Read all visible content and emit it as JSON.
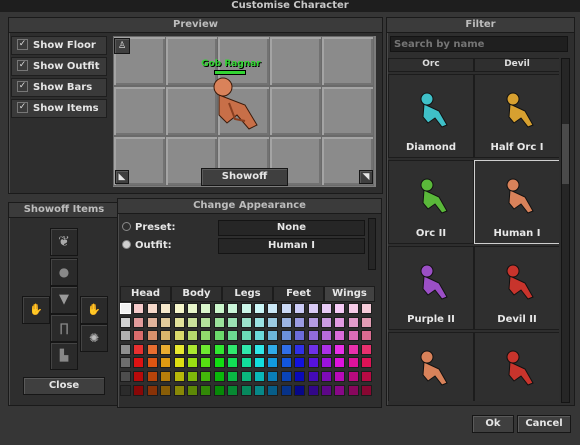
{
  "window": {
    "title": "Customise Character"
  },
  "preview": {
    "title": "Preview",
    "checkboxes": [
      {
        "label": "Show Floor",
        "checked": true
      },
      {
        "label": "Show Outfit",
        "checked": true
      },
      {
        "label": "Show Bars",
        "checked": true
      },
      {
        "label": "Show Items",
        "checked": true
      }
    ],
    "character_name": "Gob Ragnar",
    "showoff_button": "Showoff"
  },
  "showoff": {
    "title": "Showoff Items",
    "close_button": "Close"
  },
  "appearance": {
    "title": "Change Appearance",
    "preset_label": "Preset:",
    "preset_value": "None",
    "outfit_label": "Outfit:",
    "outfit_value": "Human I",
    "selected_radio": "outfit",
    "tabs": [
      "Head",
      "Body",
      "Legs",
      "Feet",
      "Wings"
    ],
    "active_tab": "Wings"
  },
  "filter": {
    "title": "Filter",
    "search_placeholder": "Search by name",
    "partial_header": [
      "Orc",
      "Devil"
    ],
    "outfits": [
      {
        "label": "Diamond",
        "color": "#3fc0c8"
      },
      {
        "label": "Half Orc I",
        "color": "#d7a030"
      },
      {
        "label": "Orc II",
        "color": "#5ab83a"
      },
      {
        "label": "Human I",
        "color": "#d9825a",
        "selected": true
      },
      {
        "label": "Purple II",
        "color": "#9b4fc6"
      },
      {
        "label": "Devil II",
        "color": "#c8342c"
      },
      {
        "label": "",
        "color": "#d9825a"
      },
      {
        "label": "",
        "color": "#c8342c"
      }
    ]
  },
  "footer": {
    "ok_button": "Ok",
    "cancel_button": "Cancel"
  },
  "colors": {
    "accent_name": "#33d433"
  }
}
